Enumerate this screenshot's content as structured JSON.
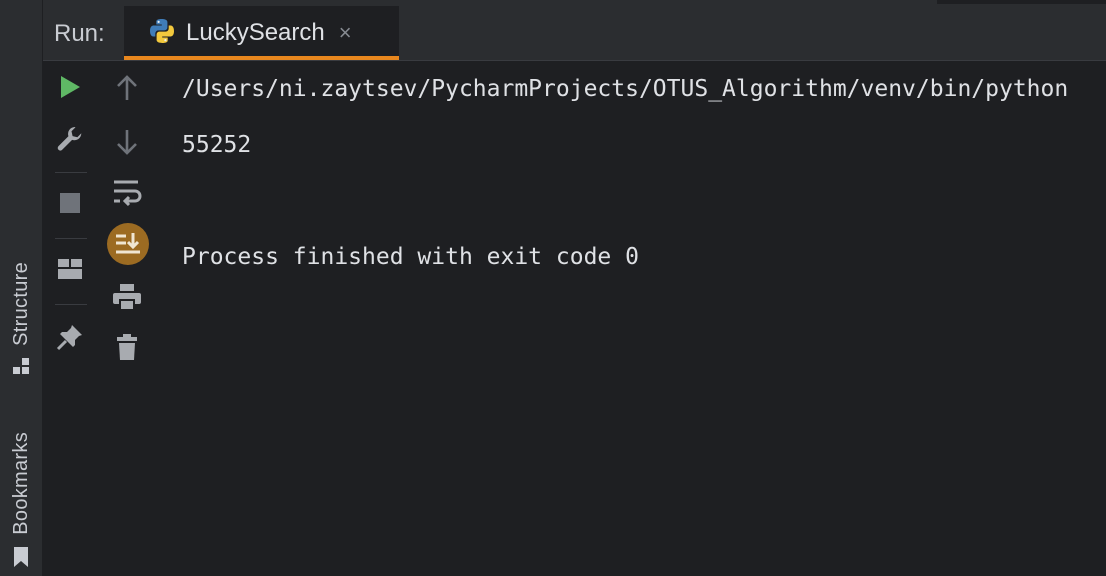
{
  "left_stripe": {
    "structure_label": "Structure",
    "bookmarks_label": "Bookmarks"
  },
  "header": {
    "run_label": "Run:",
    "tab_label": "LuckySearch",
    "tab_close": "×"
  },
  "toolbar_left": [
    "run-icon",
    "wrench-icon",
    "stop-icon",
    "layout-icon",
    "pin-icon"
  ],
  "toolbar_right": [
    "arrow-up-icon",
    "arrow-down-icon",
    "soft-wrap-icon",
    "scroll-to-end-icon",
    "print-icon",
    "trash-icon"
  ],
  "console": {
    "line1": "/Users/ni.zaytsev/PycharmProjects/OTUS_Algorithm/venv/bin/python",
    "line2": "55252",
    "line3": "Process finished with exit code 0"
  },
  "colors": {
    "accent": "#e8871e",
    "run_green": "#5fb865",
    "icon_gray": "#a8abb0",
    "background": "#1e1f22"
  }
}
